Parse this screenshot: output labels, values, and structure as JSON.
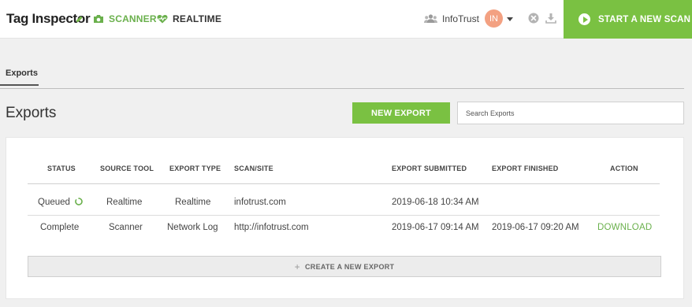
{
  "header": {
    "logo_text_before": "Tag Inspect",
    "logo_text_o": "o",
    "logo_text_after": "r",
    "nav": {
      "scanner_label": "SCANNER",
      "realtime_label": "REALTIME"
    },
    "account_name": "InfoTrust",
    "avatar_initials": "IN",
    "start_scan_label": "START A NEW SCAN",
    "colors": {
      "accent": "#7ac142",
      "avatar": "#f3a182"
    }
  },
  "tabs": [
    {
      "label": "Exports",
      "active": true
    }
  ],
  "page": {
    "title": "Exports",
    "new_export_label": "NEW EXPORT",
    "search_placeholder": "Search Exports"
  },
  "table": {
    "columns": [
      "STATUS",
      "SOURCE TOOL",
      "EXPORT TYPE",
      "SCAN/SITE",
      "EXPORT SUBMITTED",
      "EXPORT FINISHED",
      "ACTION"
    ],
    "rows": [
      {
        "status": "Queued",
        "source_tool": "Realtime",
        "export_type": "Realtime",
        "site": "infotrust.com",
        "submitted": "2019-06-18 10:34 AM",
        "finished": "",
        "action": ""
      },
      {
        "status": "Complete",
        "source_tool": "Scanner",
        "export_type": "Network Log",
        "site": "http://infotrust.com",
        "submitted": "2019-06-17 09:14 AM",
        "finished": "2019-06-17 09:20 AM",
        "action": "DOWNLOAD"
      }
    ]
  },
  "create_export_label": "CREATE A NEW EXPORT",
  "icons": [
    "camera-icon",
    "heart-pulse-icon",
    "users-icon",
    "close-circle-icon",
    "download-icon",
    "play-icon",
    "spinner-icon",
    "plus-icon"
  ]
}
